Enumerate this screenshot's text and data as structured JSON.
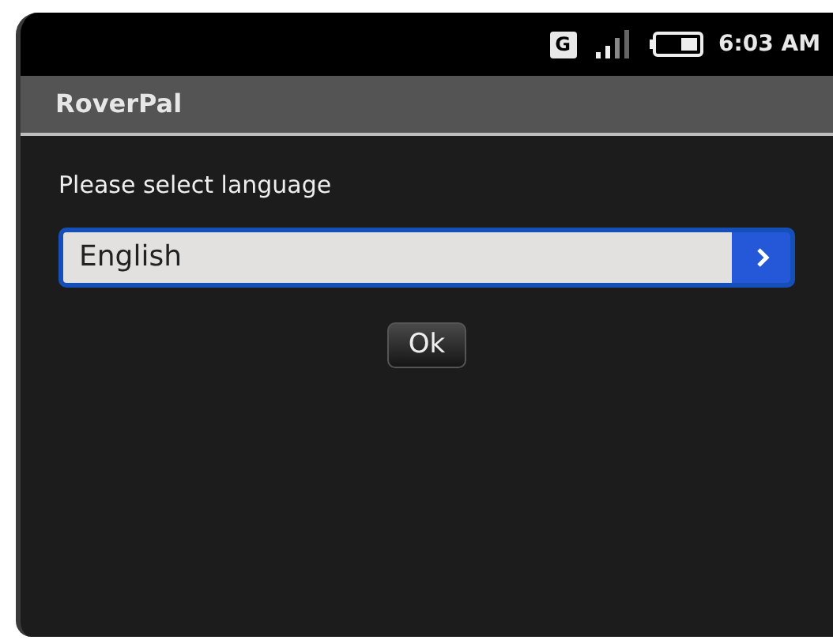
{
  "status_bar": {
    "network": "G",
    "time": "6:03 AM"
  },
  "window": {
    "title": "RoverPal"
  },
  "prompt": "Please select language",
  "spinner": {
    "value": "English",
    "focused": true
  },
  "buttons": [
    "Ok"
  ]
}
